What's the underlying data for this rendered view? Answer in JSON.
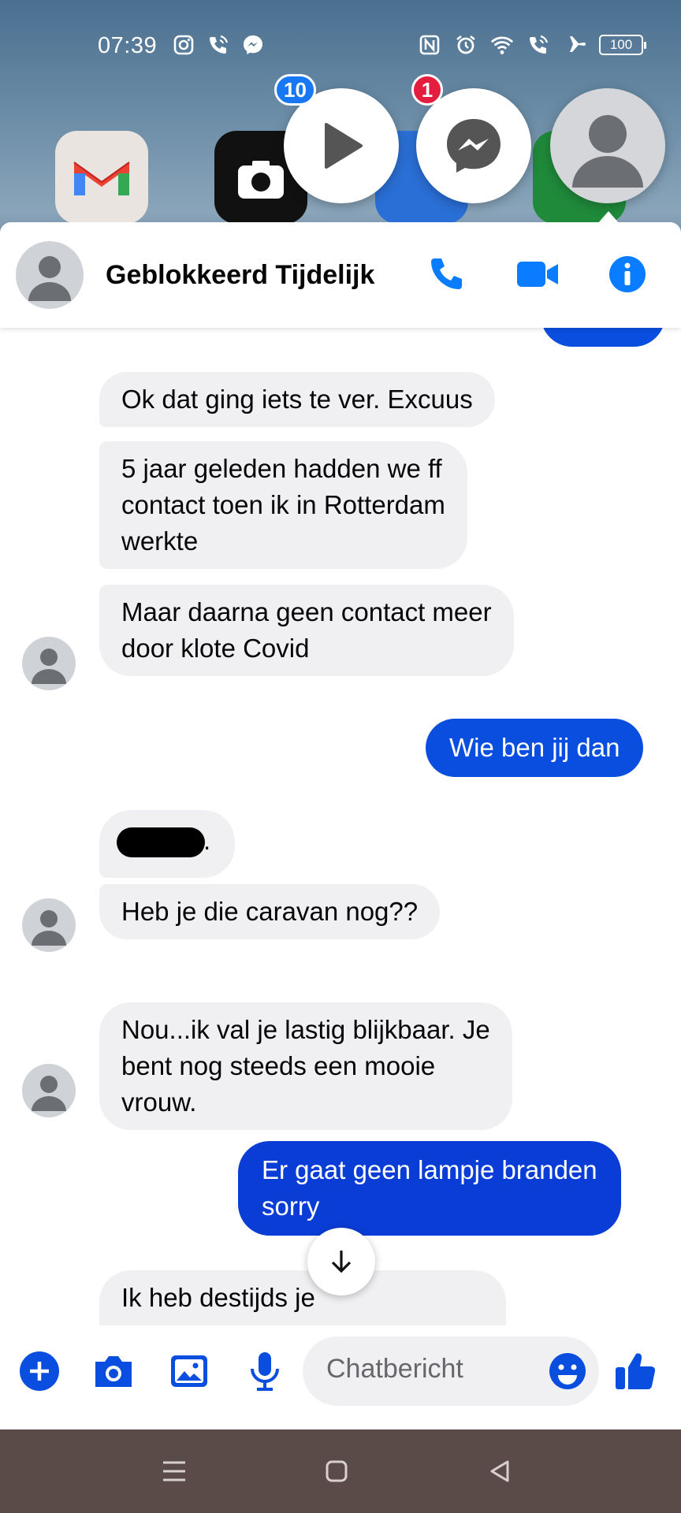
{
  "status_bar": {
    "time": "07:39",
    "left_icons": [
      "instagram-icon",
      "wifi-call-icon",
      "messenger-icon"
    ],
    "right_icons": [
      "nfc-icon",
      "alarm-icon",
      "wifi-icon",
      "wifi-call-icon",
      "airplane-icon"
    ],
    "battery": "100"
  },
  "chat_heads": [
    {
      "name": "video-app",
      "badge": "10",
      "badge_color": "#1877f2"
    },
    {
      "name": "messenger",
      "badge": "1",
      "badge_color": "#e41e3f"
    },
    {
      "name": "contact-avatar",
      "badge": ""
    }
  ],
  "header": {
    "contact_name": "Geblokkeerd Tijdelijk",
    "actions": [
      "phone-icon",
      "video-camera-icon",
      "info-icon"
    ]
  },
  "messages": [
    {
      "side": "received",
      "text": "Ok dat ging iets te ver. Excuus"
    },
    {
      "side": "received",
      "text": "5 jaar geleden hadden we ff\ncontact toen ik in Rotterdam\nwerkte"
    },
    {
      "side": "received",
      "text": "Maar daarna geen contact meer\ndoor klote Covid"
    },
    {
      "side": "sent",
      "text": "Wie ben jij dan"
    },
    {
      "side": "received",
      "text": "."
    },
    {
      "side": "received",
      "text": "Heb je die caravan nog??"
    },
    {
      "side": "received",
      "text": "Nou...ik val je lastig blijkbaar. Je\nbent nog steeds een mooie\nvrouw."
    },
    {
      "side": "sent",
      "text": "Er gaat geen lampje branden\nsorry"
    },
    {
      "side": "received",
      "text": "Ik heb destijds je"
    }
  ],
  "composer": {
    "placeholder": "Chatbericht",
    "buttons": [
      "plus-icon",
      "camera-icon",
      "image-icon",
      "microphone-icon",
      "emoji-icon",
      "thumbs-up-icon"
    ]
  },
  "colors": {
    "accent": "#0a7cff",
    "sent_bubble": "#0a4ee0",
    "received_bubble": "#f0f0f2"
  }
}
